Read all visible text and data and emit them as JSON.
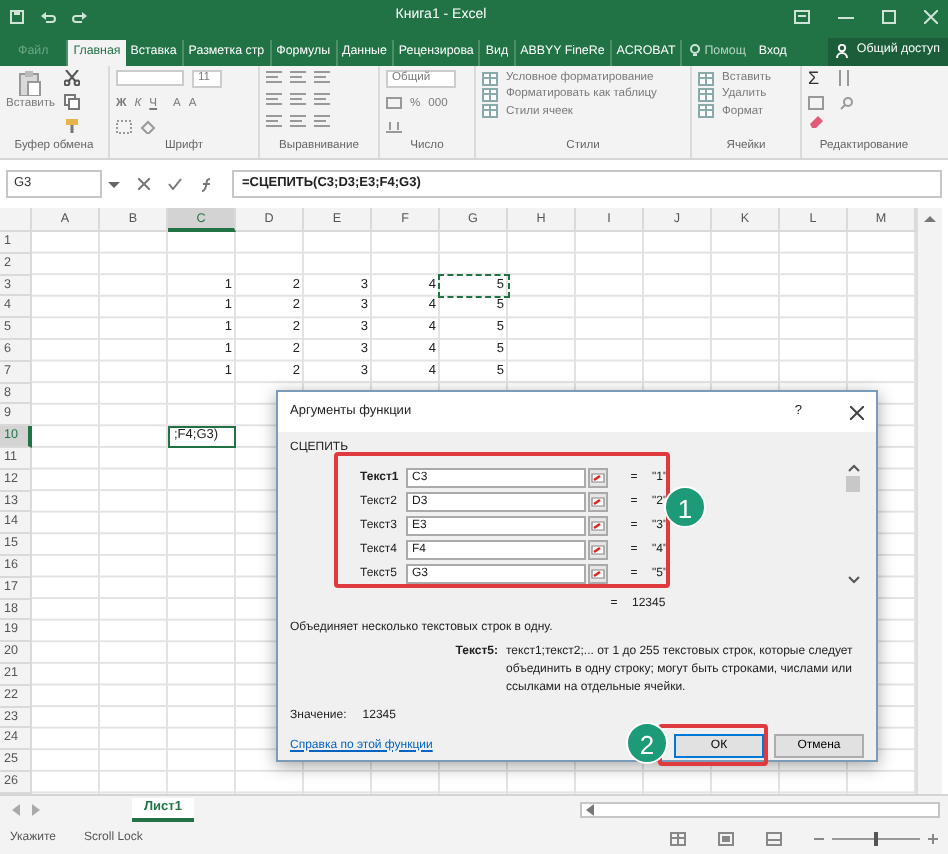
{
  "window": {
    "title": "Книга1 - Excel"
  },
  "ribbon_tabs": [
    {
      "label": "Файл",
      "selected": false,
      "kind": "file"
    },
    {
      "label": "Главная",
      "selected": true
    },
    {
      "label": "Вставка",
      "selected": false
    },
    {
      "label": "Разметка стр",
      "selected": false
    },
    {
      "label": "Формулы",
      "selected": false
    },
    {
      "label": "Данные",
      "selected": false
    },
    {
      "label": "Рецензирова",
      "selected": false
    },
    {
      "label": "Вид",
      "selected": false
    },
    {
      "label": "ABBYY FineRe",
      "selected": false
    },
    {
      "label": "ACROBAT",
      "selected": false
    }
  ],
  "tell_me": "Помощ",
  "sign_in": "Вход",
  "share": "Общий доступ",
  "ribbon_groups": [
    {
      "label": "Буфер обмена",
      "kind": "clipboard",
      "items": [
        "Вставить"
      ]
    },
    {
      "label": "Шрифт",
      "kind": "font",
      "items": [
        "11",
        "Ж",
        "К",
        "Ч",
        "A",
        "A"
      ]
    },
    {
      "label": "Выравнивание",
      "kind": "align"
    },
    {
      "label": "Число",
      "kind": "number",
      "items": [
        "Общий",
        "%",
        "000"
      ]
    },
    {
      "label": "Стили",
      "kind": "list",
      "items": [
        "Условное форматирование",
        "Форматировать как таблицу",
        "Стили ячеек"
      ]
    },
    {
      "label": "Ячейки",
      "kind": "list",
      "items": [
        "Вставить",
        "Удалить",
        "Формат"
      ]
    },
    {
      "label": "Редактирование",
      "kind": "edit",
      "items": [
        "Σ"
      ]
    }
  ],
  "name_box": "G3",
  "formula": "=СЦЕПИТЬ(C3;D3;E3;F4;G3)",
  "sheet": {
    "columns": [
      {
        "label": "A",
        "selected": false
      },
      {
        "label": "B",
        "selected": false
      },
      {
        "label": "C",
        "selected": true
      },
      {
        "label": "D",
        "selected": false
      },
      {
        "label": "E",
        "selected": false
      },
      {
        "label": "F",
        "selected": false
      },
      {
        "label": "G",
        "selected": false
      },
      {
        "label": "H",
        "selected": false
      },
      {
        "label": "I",
        "selected": false
      },
      {
        "label": "J",
        "selected": false
      },
      {
        "label": "K",
        "selected": false
      },
      {
        "label": "L",
        "selected": false
      },
      {
        "label": "M",
        "selected": false
      }
    ],
    "rows": [
      {
        "number": "1",
        "selected": false
      },
      {
        "number": "2",
        "selected": false
      },
      {
        "number": "3",
        "selected": false,
        "cells": [
          null,
          null,
          {
            "text": "1",
            "kind": "number",
            "marquee": false,
            "active": false
          },
          {
            "text": "2",
            "kind": "number",
            "marquee": false,
            "active": false
          },
          {
            "text": "3",
            "kind": "number",
            "marquee": false,
            "active": false
          },
          {
            "text": "4",
            "kind": "number",
            "marquee": false,
            "active": false
          },
          {
            "text": "5",
            "kind": "number",
            "marquee": true,
            "active": false
          }
        ]
      },
      {
        "number": "4",
        "selected": false,
        "cells": [
          null,
          null,
          {
            "text": "1",
            "kind": "number",
            "marquee": false,
            "active": false
          },
          {
            "text": "2",
            "kind": "number",
            "marquee": false,
            "active": false
          },
          {
            "text": "3",
            "kind": "number",
            "marquee": false,
            "active": false
          },
          {
            "text": "4",
            "kind": "number",
            "marquee": false,
            "active": false
          },
          {
            "text": "5",
            "kind": "number",
            "marquee": false,
            "active": false
          }
        ]
      },
      {
        "number": "5",
        "selected": false,
        "cells": [
          null,
          null,
          {
            "text": "1",
            "kind": "number",
            "marquee": false,
            "active": false
          },
          {
            "text": "2",
            "kind": "number",
            "marquee": false,
            "active": false
          },
          {
            "text": "3",
            "kind": "number",
            "marquee": false,
            "active": false
          },
          {
            "text": "4",
            "kind": "number",
            "marquee": false,
            "active": false
          },
          {
            "text": "5",
            "kind": "number",
            "marquee": false,
            "active": false
          }
        ]
      },
      {
        "number": "6",
        "selected": false,
        "cells": [
          null,
          null,
          {
            "text": "1",
            "kind": "number",
            "marquee": false,
            "active": false
          },
          {
            "text": "2",
            "kind": "number",
            "marquee": false,
            "active": false
          },
          {
            "text": "3",
            "kind": "number",
            "marquee": false,
            "active": false
          },
          {
            "text": "4",
            "kind": "number",
            "marquee": false,
            "active": false
          },
          {
            "text": "5",
            "kind": "number",
            "marquee": false,
            "active": false
          }
        ]
      },
      {
        "number": "7",
        "selected": false,
        "cells": [
          null,
          null,
          {
            "text": "1",
            "kind": "number",
            "marquee": false,
            "active": false
          },
          {
            "text": "2",
            "kind": "number",
            "marquee": false,
            "active": false
          },
          {
            "text": "3",
            "kind": "number",
            "marquee": false,
            "active": false
          },
          {
            "text": "4",
            "kind": "number",
            "marquee": false,
            "active": false
          },
          {
            "text": "5",
            "kind": "number",
            "marquee": false,
            "active": false
          }
        ]
      },
      {
        "number": "8",
        "selected": false
      },
      {
        "number": "9",
        "selected": false
      },
      {
        "number": "10",
        "selected": true,
        "cells": [
          null,
          null,
          {
            "text": ";F4;G3)",
            "kind": "text",
            "marquee": false,
            "active": true
          }
        ]
      },
      {
        "number": "11",
        "selected": false
      },
      {
        "number": "12",
        "selected": false
      },
      {
        "number": "13",
        "selected": false
      },
      {
        "number": "14",
        "selected": false
      },
      {
        "number": "15",
        "selected": false
      },
      {
        "number": "16",
        "selected": false
      },
      {
        "number": "17",
        "selected": false
      },
      {
        "number": "18",
        "selected": false
      },
      {
        "number": "19",
        "selected": false
      },
      {
        "number": "20",
        "selected": false
      },
      {
        "number": "21",
        "selected": false
      },
      {
        "number": "22",
        "selected": false
      },
      {
        "number": "23",
        "selected": false
      },
      {
        "number": "24",
        "selected": false
      },
      {
        "number": "25",
        "selected": false
      },
      {
        "number": "26",
        "selected": false
      }
    ]
  },
  "sheet_tabs": [
    {
      "label": "Лист1",
      "selected": true
    }
  ],
  "status_bar": [
    "Укажите",
    "Scroll Lock"
  ],
  "zoom": {
    "level": 0.5
  },
  "dialog": {
    "title": "Аргументы функции",
    "help": "?",
    "function_name": "СЦЕПИТЬ",
    "arguments": [
      {
        "label": "Текст1",
        "value": "C3",
        "equals": "=",
        "result": "\"1\"",
        "required": true
      },
      {
        "label": "Текст2",
        "value": "D3",
        "equals": "=",
        "result": "\"2\"",
        "required": false
      },
      {
        "label": "Текст3",
        "value": "E3",
        "equals": "=",
        "result": "\"3\"",
        "required": false
      },
      {
        "label": "Текст4",
        "value": "F4",
        "equals": "=",
        "result": "\"4\"",
        "required": false
      },
      {
        "label": "Текст5",
        "value": "G3",
        "equals": "=",
        "result": "\"5\"",
        "required": false
      }
    ],
    "total_equals": "=",
    "total": "12345",
    "description": "Объединяет несколько текстовых строк в одну.",
    "arg_help_label": "Текст5:",
    "arg_help": "текст1;текст2;... от 1 до 255 текстовых строк, которые следует объединить в одну строку; могут быть строками, числами или ссылками на отдельные ячейки.",
    "value_label": "Значение:",
    "value": "12345",
    "help_link": "Справка по этой функции",
    "buttons": [
      {
        "label": "ОК",
        "kind": "ok"
      },
      {
        "label": "Отмена",
        "kind": "cancel"
      }
    ]
  },
  "annotations": [
    {
      "label": "1",
      "kind": "arguments"
    },
    {
      "label": "2",
      "kind": "ok"
    }
  ]
}
